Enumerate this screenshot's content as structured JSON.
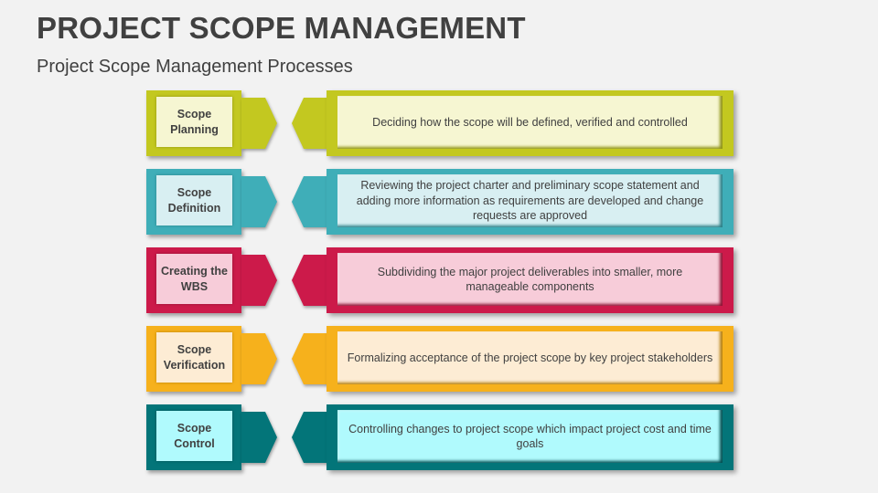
{
  "header": {
    "title": "PROJECT SCOPE MANAGEMENT",
    "subtitle": "Project Scope Management Processes"
  },
  "processes": [
    {
      "name": "Scope Planning",
      "name_lines": [
        "Scope",
        "Planning"
      ],
      "description": "Deciding how the scope will be defined, verified and controlled",
      "color": "#c3c820",
      "shade": "#8f9314",
      "fill": "#f6f6d2"
    },
    {
      "name": "Scope Definition",
      "name_lines": [
        "Scope",
        "Definition"
      ],
      "description": "Reviewing the project charter and preliminary scope statement and adding more information as requirements are developed and change requests are approved",
      "color": "#3faeb8",
      "shade": "#2a7f87",
      "fill": "#d8eff2"
    },
    {
      "name": "Creating the WBS",
      "name_lines": [
        "Creating the",
        "WBS"
      ],
      "description": "Subdividing the major project deliverables into smaller, more manageable components",
      "color": "#cc1a4a",
      "shade": "#8e1133",
      "fill": "#f7ccd9"
    },
    {
      "name": "Scope Verification",
      "name_lines": [
        "Scope",
        "Verification"
      ],
      "description": "Formalizing acceptance of the project scope by key project stakeholders",
      "color": "#f6b11c",
      "shade": "#b57f0c",
      "fill": "#fdecd4"
    },
    {
      "name": "Scope Control",
      "name_lines": [
        "Scope",
        "Control"
      ],
      "description": "Controlling changes to project scope which impact project cost and time goals",
      "color": "#037579",
      "shade": "#024e51",
      "fill": "#b0fafd"
    }
  ]
}
